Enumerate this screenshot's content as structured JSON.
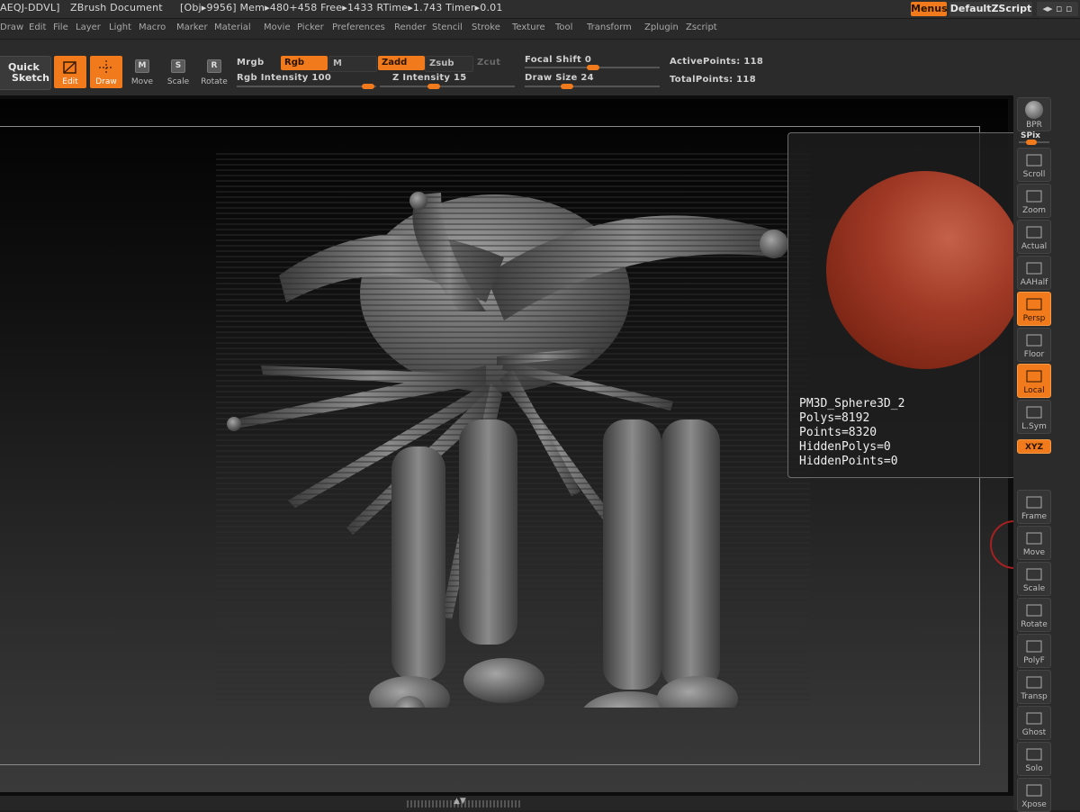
{
  "titlebar": {
    "app_id": "AEQJ-DDVL]",
    "document": "ZBrush Document",
    "stats": "[Obj▸9956] Mem▸480+458  Free▸1433  RTime▸1.743  Timer▸0.01",
    "menus_button": "Menus",
    "script_button": "DefaultZScript"
  },
  "menubar": {
    "items": [
      "Draw",
      "Edit",
      "File",
      "Layer",
      "Light",
      "Macro",
      "Marker",
      "Material",
      "Movie",
      "Picker",
      "Preferences",
      "Render",
      "Stencil",
      "Stroke",
      "Texture",
      "Tool",
      "Transform",
      "Zplugin",
      "Zscript"
    ]
  },
  "toolbar": {
    "quick_sketch": [
      "Quick",
      "Sketch"
    ],
    "tools": [
      {
        "label": "Edit",
        "key": "",
        "active": true
      },
      {
        "label": "Draw",
        "key": "",
        "active": true
      },
      {
        "label": "Move",
        "key": "M",
        "active": false
      },
      {
        "label": "Scale",
        "key": "S",
        "active": false
      },
      {
        "label": "Rotate",
        "key": "R",
        "active": false
      }
    ],
    "mrgb": "Mrgb",
    "rgb": "Rgb",
    "m": "M",
    "rgb_intensity": "Rgb  Intensity 100",
    "zadd": "Zadd",
    "zsub": "Zsub",
    "zcut": "Zcut",
    "z_intensity": "Z  Intensity 15",
    "focal_shift": "Focal  Shift 0",
    "draw_size": "Draw  Size 24",
    "active_points": "ActivePoints: 118",
    "total_points": "TotalPoints: 118"
  },
  "preview": {
    "name": "PM3D_Sphere3D_2",
    "polys": "Polys=8192",
    "points": "Points=8320",
    "hidden_polys": "HiddenPolys=0",
    "hidden_points": "HiddenPoints=0"
  },
  "right_tray": {
    "bpr": "BPR",
    "spix": "SPix",
    "buttons": [
      {
        "label": "Scroll",
        "active": false
      },
      {
        "label": "Zoom",
        "active": false
      },
      {
        "label": "Actual",
        "active": false
      },
      {
        "label": "AAHalf",
        "active": false
      },
      {
        "label": "Persp",
        "active": true
      },
      {
        "label": "Floor",
        "active": false
      },
      {
        "label": "Local",
        "active": true
      },
      {
        "label": "L.Sym",
        "active": false
      },
      {
        "label": "XYZ",
        "active": true
      },
      {
        "label": "Frame",
        "active": false
      },
      {
        "label": "Move",
        "active": false
      },
      {
        "label": "Scale",
        "active": false
      },
      {
        "label": "Rotate",
        "active": false
      },
      {
        "label": "PolyF",
        "active": false
      },
      {
        "label": "Transp",
        "active": false
      },
      {
        "label": "Ghost",
        "active": false
      },
      {
        "label": "Solo",
        "active": false
      },
      {
        "label": "Xpose",
        "active": false
      }
    ]
  },
  "colors": {
    "accent": "#f07a1c",
    "sphere": "#a13a26"
  }
}
